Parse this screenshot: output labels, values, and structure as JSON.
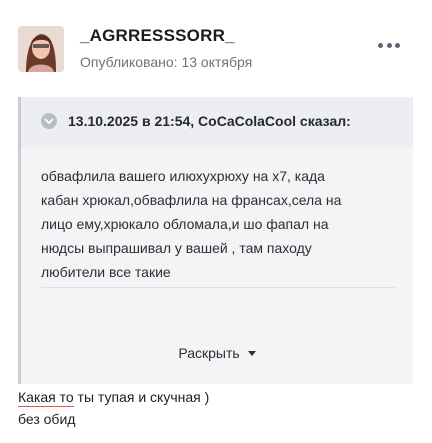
{
  "post": {
    "author": "_AGRRESSSORR_",
    "published_label": "Опубликовано:",
    "published_date": "13 октября",
    "more_icon": "more-horizontal-icon"
  },
  "quote": {
    "citation": "13.10.2025 в 21:54, CoCaColaCool сказал:",
    "icon": "quote-icon",
    "lines": [
      "обвафлила вашего илюхухрюху на х7, када",
      "кабан хрюкал,обвафлила на франсах,села на",
      "лицо ему,хрюкало обломала,и шо фапал на",
      "нюдсы выпрашивал у вашей , там паходу",
      "любители все такие"
    ],
    "expand_label": "Раскрыть"
  },
  "reply": {
    "line1_marked": "Какая то",
    "line1_rest": " ты тупая и скучная )",
    "line2": "без обид"
  },
  "colors": {
    "meta_text": "#6f7378",
    "quote_bg": "#f3f4f6",
    "quote_border": "#c9ccd1",
    "spell_underline": "#e05656"
  }
}
